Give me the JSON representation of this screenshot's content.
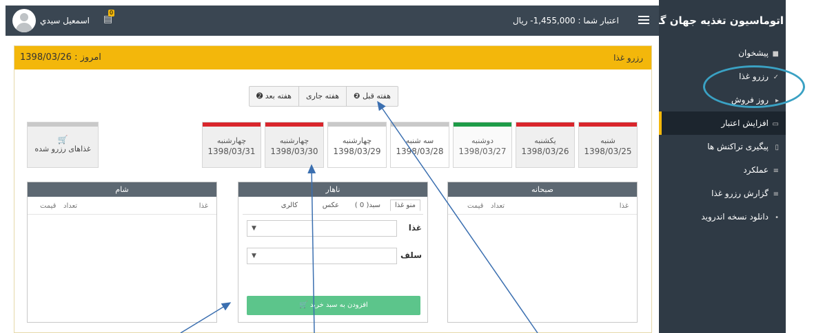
{
  "app": {
    "title": "اتوماسیون تغذیه جهان گستر"
  },
  "header": {
    "username": "اسمعيل سيدي",
    "credit": "اعتبار شما : 1,455,000- ريال",
    "badge": "0"
  },
  "sidebar": {
    "items": [
      {
        "label": "پیشخوان",
        "icon": "desktop-icon"
      },
      {
        "label": "رزرو غذا",
        "icon": "check-icon"
      },
      {
        "label": "روز فروش",
        "icon": "tag-icon"
      },
      {
        "label": "افزایش اعتبار",
        "icon": "credit-card-icon"
      },
      {
        "label": "پیگیری تراکنش ها",
        "icon": "file-icon"
      },
      {
        "label": "عملکرد",
        "icon": "list-icon"
      },
      {
        "label": "گزارش رزرو غذا",
        "icon": "report-icon"
      },
      {
        "label": "دانلود نسخه اندروید",
        "icon": "android-icon"
      }
    ]
  },
  "panel": {
    "title": "رزرو غذا",
    "today": "امروز : 1398/03/26"
  },
  "weeknav": {
    "prev": "هفته قبل",
    "current": "هفته جاری",
    "next": "هفته بعد"
  },
  "days": [
    {
      "name": "شنبه",
      "date": "1398/03/25",
      "status": "closed"
    },
    {
      "name": "یکشنبه",
      "date": "1398/03/26",
      "status": "closed"
    },
    {
      "name": "دوشنبه",
      "date": "1398/03/27",
      "status": "selected"
    },
    {
      "name": "سه شنبه",
      "date": "1398/03/28",
      "status": "open"
    },
    {
      "name": "چهارشنبه",
      "date": "1398/03/29",
      "status": "open"
    },
    {
      "name": "چهارشنبه",
      "date": "1398/03/30",
      "status": "closed"
    },
    {
      "name": "چهارشنبه",
      "date": "1398/03/31",
      "status": "closed"
    }
  ],
  "reserved": {
    "label": "غذاهای رزرو شده"
  },
  "meals": {
    "breakfast": {
      "title": "صبحانه",
      "col_food": "غذا",
      "col_count": "تعداد",
      "col_price": "قیمت"
    },
    "lunch": {
      "title": "ناهار"
    },
    "dinner": {
      "title": "شام",
      "col_food": "غذا",
      "col_count": "تعداد",
      "col_price": "قیمت"
    }
  },
  "lunch": {
    "tabs": [
      "منو غذا",
      "سبد( 0 )",
      "عکس",
      "کالری"
    ],
    "food_label": "غذا",
    "hall_label": "سلف",
    "add_button": "افزودن به سبد خرید"
  },
  "colors": {
    "accent": "#f3b70b",
    "red": "#d9262c",
    "green": "#1e9c48",
    "gray": "#c9c9c9"
  }
}
